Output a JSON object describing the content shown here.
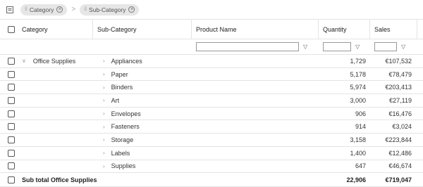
{
  "group_panel": {
    "chips": [
      {
        "label": "Category"
      },
      {
        "label": "Sub-Category"
      }
    ],
    "separator": ">"
  },
  "columns": {
    "category": "Category",
    "sub_category": "Sub-Category",
    "product_name": "Product Name",
    "quantity": "Quantity",
    "sales": "Sales"
  },
  "group": {
    "label": "Office Supplies",
    "expanded": true
  },
  "rows": [
    {
      "sub": "Appliances",
      "qty": "1,729",
      "sales": "€107,532"
    },
    {
      "sub": "Paper",
      "qty": "5,178",
      "sales": "€78,479"
    },
    {
      "sub": "Binders",
      "qty": "5,974",
      "sales": "€203,413"
    },
    {
      "sub": "Art",
      "qty": "3,000",
      "sales": "€27,119"
    },
    {
      "sub": "Envelopes",
      "qty": "906",
      "sales": "€16,476"
    },
    {
      "sub": "Fasteners",
      "qty": "914",
      "sales": "€3,024"
    },
    {
      "sub": "Storage",
      "qty": "3,158",
      "sales": "€223,844"
    },
    {
      "sub": "Labels",
      "qty": "1,400",
      "sales": "€12,486"
    },
    {
      "sub": "Supplies",
      "qty": "647",
      "sales": "€46,674"
    }
  ],
  "subtotal": {
    "label": "Sub total Office Supplies",
    "qty": "22,906",
    "sales": "€719,047"
  },
  "icons": {
    "group_panel": "group-panel-icon",
    "grip": "grip-icon",
    "remove": "remove-circle-icon",
    "expand": "chevron-down-icon",
    "collapse": "chevron-right-icon",
    "filter": "filter-icon"
  }
}
